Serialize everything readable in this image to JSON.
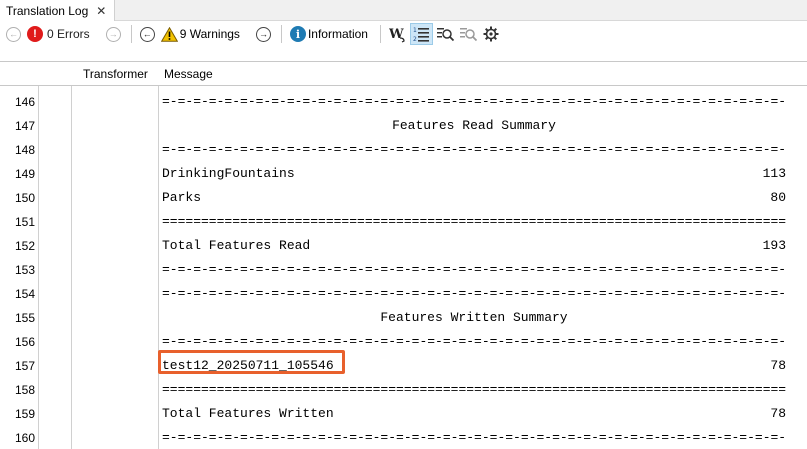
{
  "tab": {
    "label": "Translation Log",
    "close_glyph": "✕"
  },
  "toolbar": {
    "errors_label": "0 Errors",
    "warnings_label": "9 Warnings",
    "information_label": "Information"
  },
  "table": {
    "headers": {
      "transformer": "Transformer",
      "message": "Message"
    },
    "rows": [
      {
        "num": "146",
        "message": "=-=-=-=-=-=-=-=-=-=-=-=-=-=-=-=-=-=-=-=-=-=-=-=-=-=-=-=-=-=-=-=-=-=-=-=-=-=-=-=-=-=-=-=-=-=-=-=-=-=",
        "value": ""
      },
      {
        "num": "147",
        "message": "Features Read Summary",
        "value": ""
      },
      {
        "num": "148",
        "message": "=-=-=-=-=-=-=-=-=-=-=-=-=-=-=-=-=-=-=-=-=-=-=-=-=-=-=-=-=-=-=-=-=-=-=-=-=-=-=-=-=-=-=-=-=-=-=-=-=-=",
        "value": ""
      },
      {
        "num": "149",
        "message": "DrinkingFountains",
        "value": "113"
      },
      {
        "num": "150",
        "message": "Parks",
        "value": "80"
      },
      {
        "num": "151",
        "message": "==================================================================================================",
        "value": ""
      },
      {
        "num": "152",
        "message": "Total Features Read",
        "value": "193"
      },
      {
        "num": "153",
        "message": "=-=-=-=-=-=-=-=-=-=-=-=-=-=-=-=-=-=-=-=-=-=-=-=-=-=-=-=-=-=-=-=-=-=-=-=-=-=-=-=-=-=-=-=-=-=-=-=-=-=",
        "value": ""
      },
      {
        "num": "154",
        "message": "=-=-=-=-=-=-=-=-=-=-=-=-=-=-=-=-=-=-=-=-=-=-=-=-=-=-=-=-=-=-=-=-=-=-=-=-=-=-=-=-=-=-=-=-=-=-=-=-=-=",
        "value": ""
      },
      {
        "num": "155",
        "message": "Features Written Summary",
        "value": ""
      },
      {
        "num": "156",
        "message": "=-=-=-=-=-=-=-=-=-=-=-=-=-=-=-=-=-=-=-=-=-=-=-=-=-=-=-=-=-=-=-=-=-=-=-=-=-=-=-=-=-=-=-=-=-=-=-=-=-=",
        "value": ""
      },
      {
        "num": "157",
        "message": "test12_20250711_105546",
        "value": "78"
      },
      {
        "num": "158",
        "message": "==================================================================================================",
        "value": ""
      },
      {
        "num": "159",
        "message": "Total Features Written",
        "value": "78"
      },
      {
        "num": "160",
        "message": "=-=-=-=-=-=-=-=-=-=-=-=-=-=-=-=-=-=-=-=-=-=-=-=-=-=-=-=-=-=-=-=-=-=-=-=-=-=-=-=-=-=-=-=-=-=-=-=-=-=",
        "value": ""
      }
    ]
  },
  "colors": {
    "highlight": "#e8602c",
    "error": "#e01b1b",
    "info": "#1f7bb3",
    "warning": "#f2c200"
  },
  "icons": {
    "nav_prev_error": "circle-arrow-left-icon",
    "nav_next_error": "circle-arrow-right-icon",
    "error": "error-icon",
    "warning": "warning-icon",
    "information": "information-icon",
    "word_wrap": "word-wrap-icon",
    "line_numbers": "line-numbers-icon",
    "find": "find-icon",
    "find_next": "find-next-icon",
    "settings": "gear-icon"
  }
}
